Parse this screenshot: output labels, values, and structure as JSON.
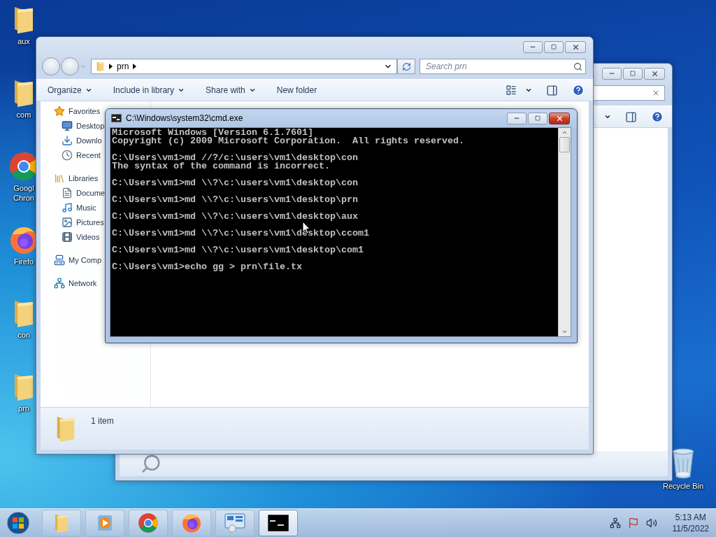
{
  "desktop": {
    "left_icons": [
      {
        "kind": "folder",
        "lines": [
          "aux"
        ]
      },
      {
        "kind": "folder",
        "lines": [
          "com"
        ]
      },
      {
        "kind": "chrome",
        "lines": [
          "Googl",
          "Chron"
        ]
      },
      {
        "kind": "firefox",
        "lines": [
          "Firefo"
        ]
      },
      {
        "kind": "folder",
        "lines": [
          "con"
        ]
      },
      {
        "kind": "folder",
        "lines": [
          "prn"
        ]
      }
    ],
    "right_icons": [
      {
        "kind": "recycle",
        "lines": [
          "Recycle Bin"
        ]
      }
    ]
  },
  "explorer": {
    "path": [
      "prn"
    ],
    "search": {
      "placeholder": "Search prn"
    },
    "toolbar": [
      {
        "label": "Organize",
        "dropdown": true
      },
      {
        "label": "Include in library",
        "dropdown": true
      },
      {
        "label": "Share with",
        "dropdown": true
      },
      {
        "label": "New folder",
        "dropdown": false
      }
    ],
    "sidebar": [
      {
        "label": "Favorites",
        "kind": "star",
        "children": [
          {
            "label": "Desktop",
            "kind": "desktop"
          },
          {
            "label": "Downlo",
            "kind": "download"
          },
          {
            "label": "Recent",
            "kind": "recent"
          }
        ]
      },
      {
        "label": "Libraries",
        "kind": "library",
        "children": [
          {
            "label": "Docume",
            "kind": "document"
          },
          {
            "label": "Music",
            "kind": "music"
          },
          {
            "label": "Pictures",
            "kind": "pictures"
          },
          {
            "label": "Videos",
            "kind": "videos"
          }
        ]
      },
      {
        "label": "My Comp",
        "kind": "computer"
      },
      {
        "label": "Network",
        "kind": "network"
      }
    ],
    "status": "1 item"
  },
  "cmd": {
    "title": "C:\\Windows\\system32\\cmd.exe",
    "blocks": [
      [
        "Microsoft Windows [Version 6.1.7601]",
        "Copyright (c) 2009 Microsoft Corporation.  All rights reserved."
      ],
      [
        "C:\\Users\\vm1>md //?/c:\\users\\vm1\\desktop\\con",
        "The syntax of the command is incorrect."
      ],
      [
        "C:\\Users\\vm1>md \\\\?\\c:\\users\\vm1\\desktop\\con"
      ],
      [
        "C:\\Users\\vm1>md \\\\?\\c:\\users\\vm1\\desktop\\prn"
      ],
      [
        "C:\\Users\\vm1>md \\\\?\\c:\\users\\vm1\\desktop\\aux"
      ],
      [
        "C:\\Users\\vm1>md \\\\?\\c:\\users\\vm1\\desktop\\ccom1"
      ],
      [
        "C:\\Users\\vm1>md \\\\?\\c:\\users\\vm1\\desktop\\com1"
      ],
      [
        "C:\\Users\\vm1>echo gg > prn\\file.tx"
      ]
    ]
  },
  "taskbar": {
    "apps": [
      {
        "kind": "explorer",
        "selected": false
      },
      {
        "kind": "media",
        "selected": false
      },
      {
        "kind": "chrome",
        "selected": false
      },
      {
        "kind": "firefox",
        "selected": false
      },
      {
        "kind": "control",
        "selected": false
      },
      {
        "kind": "cmd",
        "selected": true
      }
    ],
    "time": "5:13 AM",
    "date": "11/5/2022"
  }
}
